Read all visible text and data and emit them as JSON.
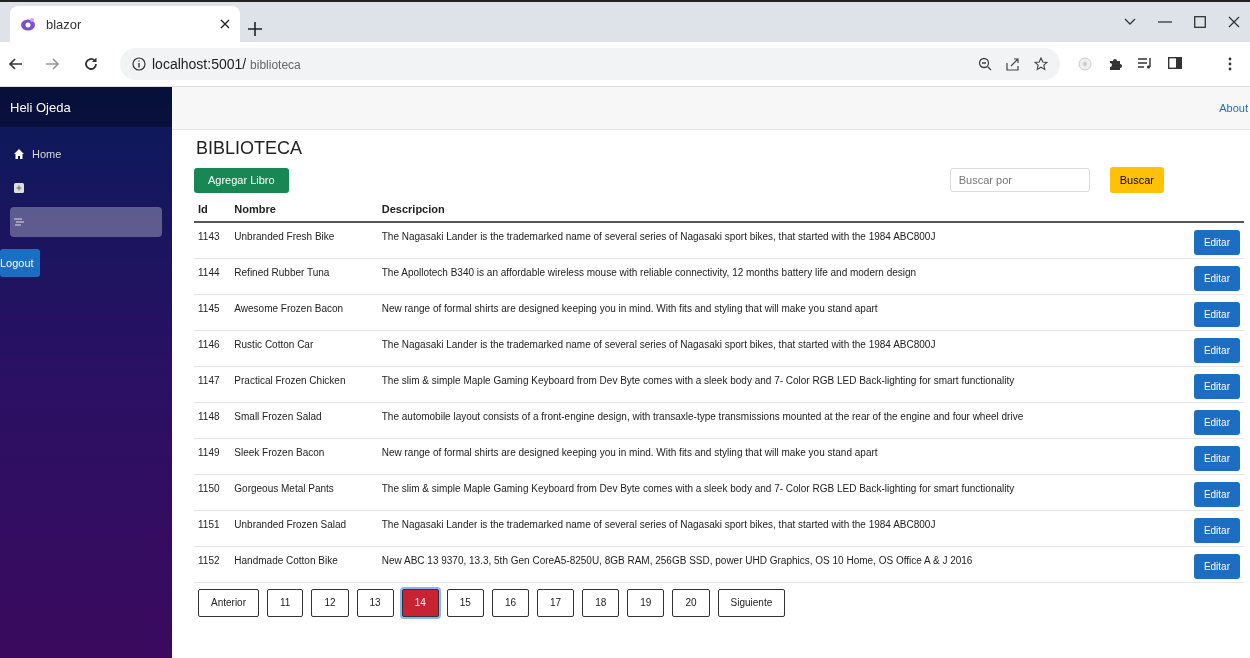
{
  "browser": {
    "tab_title": "blazor",
    "url_host": "localhost:5001/",
    "url_path": "biblioteca"
  },
  "sidebar": {
    "brand": "Heli Ojeda",
    "items": [
      {
        "label": "Home",
        "selected": false
      },
      {
        "selected": false
      },
      {
        "selected": true
      }
    ],
    "logout": "Logout"
  },
  "top_bar": {
    "link": "About"
  },
  "page": {
    "title": "BIBLIOTECA",
    "add_button": "Agregar Libro",
    "search": {
      "placeholder": "Buscar por"
    },
    "search_button": "Buscar"
  },
  "table": {
    "columns": [
      "Id",
      "Nombre",
      "Descripcion"
    ],
    "rows": [
      {
        "id": "1143",
        "nombre": "Unbranded Fresh Bike",
        "descripcion": "The Nagasaki Lander is the trademarked name of several series of Nagasaki sport bikes, that started with the 1984 ABC800J",
        "action": "Editar"
      },
      {
        "id": "1144",
        "nombre": "Refined Rubber Tuna",
        "descripcion": "The Apollotech B340 is an affordable wireless mouse with reliable connectivity, 12 months battery life and modern design",
        "action": "Editar"
      },
      {
        "id": "1145",
        "nombre": "Awesome Frozen Bacon",
        "descripcion": "New range of formal shirts are designed keeping you in mind. With fits and styling that will make you stand apart",
        "action": "Editar"
      },
      {
        "id": "1146",
        "nombre": "Rustic Cotton Car",
        "descripcion": "The Nagasaki Lander is the trademarked name of several series of Nagasaki sport bikes, that started with the 1984 ABC800J",
        "action": "Editar"
      },
      {
        "id": "1147",
        "nombre": "Practical Frozen Chicken",
        "descripcion": "The slim & simple Maple Gaming Keyboard from Dev Byte comes with a sleek body and 7- Color RGB LED Back-lighting for smart functionality",
        "action": "Editar"
      },
      {
        "id": "1148",
        "nombre": "Small Frozen Salad",
        "descripcion": "The automobile layout consists of a front-engine design, with transaxle-type transmissions mounted at the rear of the engine and four wheel drive",
        "action": "Editar"
      },
      {
        "id": "1149",
        "nombre": "Sleek Frozen Bacon",
        "descripcion": "New range of formal shirts are designed keeping you in mind. With fits and styling that will make you stand apart",
        "action": "Editar"
      },
      {
        "id": "1150",
        "nombre": "Gorgeous Metal Pants",
        "descripcion": "The slim & simple Maple Gaming Keyboard from Dev Byte comes with a sleek body and 7- Color RGB LED Back-lighting for smart functionality",
        "action": "Editar"
      },
      {
        "id": "1151",
        "nombre": "Unbranded Frozen Salad",
        "descripcion": "The Nagasaki Lander is the trademarked name of several series of Nagasaki sport bikes, that started with the 1984 ABC800J",
        "action": "Editar"
      },
      {
        "id": "1152",
        "nombre": "Handmade Cotton Bike",
        "descripcion": "New ABC 13 9370, 13.3, 5th Gen CoreA5-8250U, 8GB RAM, 256GB SSD, power UHD Graphics, OS 10 Home, OS Office A & J 2016",
        "action": "Editar"
      }
    ]
  },
  "pagination": {
    "previous": "Anterior",
    "pages": [
      {
        "label": "11",
        "selected": false
      },
      {
        "label": "12",
        "selected": false
      },
      {
        "label": "13",
        "selected": false
      },
      {
        "label": "14",
        "selected": true
      },
      {
        "label": "15",
        "selected": false
      },
      {
        "label": "16",
        "selected": false
      },
      {
        "label": "17",
        "selected": false
      },
      {
        "label": "18",
        "selected": false
      },
      {
        "label": "19",
        "selected": false
      },
      {
        "label": "20",
        "selected": false
      }
    ],
    "next": "Siguiente"
  }
}
